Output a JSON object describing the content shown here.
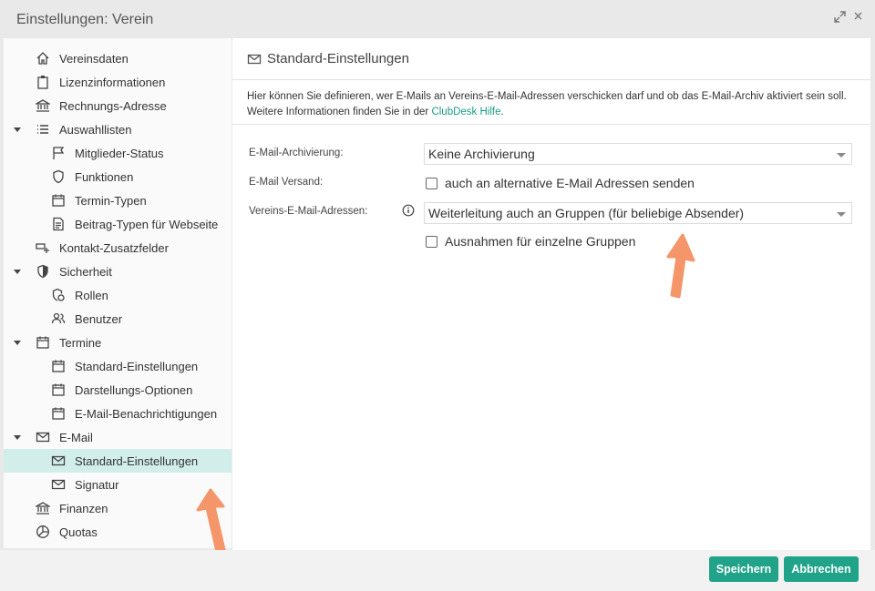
{
  "window": {
    "title": "Einstellungen: Verein"
  },
  "sidebar": {
    "items": [
      {
        "label": "Vereinsdaten",
        "icon": "home-icon"
      },
      {
        "label": "Lizenzinformationen",
        "icon": "clipboard-icon"
      },
      {
        "label": "Rechnungs-Adresse",
        "icon": "bank-icon"
      },
      {
        "label": "Auswahllisten",
        "icon": "list-icon",
        "expanded": true
      },
      {
        "label": "Mitglieder-Status",
        "icon": "flag-icon"
      },
      {
        "label": "Funktionen",
        "icon": "shield-icon"
      },
      {
        "label": "Termin-Typen",
        "icon": "calendar-icon"
      },
      {
        "label": "Beitrag-Typen für Webseite",
        "icon": "document-icon"
      },
      {
        "label": "Kontakt-Zusatzfelder",
        "icon": "field-add-icon"
      },
      {
        "label": "Sicherheit",
        "icon": "shield-check-icon",
        "expanded": true
      },
      {
        "label": "Rollen",
        "icon": "role-shield-icon"
      },
      {
        "label": "Benutzer",
        "icon": "users-icon"
      },
      {
        "label": "Termine",
        "icon": "calendar-icon",
        "expanded": true
      },
      {
        "label": "Standard-Einstellungen",
        "icon": "calendar-icon"
      },
      {
        "label": "Darstellungs-Optionen",
        "icon": "calendar-icon"
      },
      {
        "label": "E-Mail-Benachrichtigungen",
        "icon": "calendar-icon"
      },
      {
        "label": "E-Mail",
        "icon": "mail-icon",
        "expanded": true
      },
      {
        "label": "Standard-Einstellungen",
        "icon": "mail-icon",
        "selected": true
      },
      {
        "label": "Signatur",
        "icon": "mail-icon"
      },
      {
        "label": "Finanzen",
        "icon": "bank-icon"
      },
      {
        "label": "Quotas",
        "icon": "pie-chart-icon"
      }
    ]
  },
  "main": {
    "header": "Standard-Einstellungen",
    "info_text": "Hier können Sie definieren, wer E-Mails an Vereins-E-Mail-Adressen verschicken darf und ob das E-Mail-Archiv aktiviert sein soll. Weitere Informationen finden Sie in der ",
    "info_link": "ClubDesk Hilfe",
    "info_end": ".",
    "form": {
      "archive_label": "E-Mail-Archivierung:",
      "archive_value": "Keine Archivierung",
      "versand_label": "E-Mail Versand:",
      "versand_checkbox": "auch an alternative E-Mail Adressen senden",
      "addresses_label": "Vereins-E-Mail-Adressen:",
      "addresses_value": "Weiterleitung auch an Gruppen (für beliebige Absender)",
      "exceptions_checkbox": "Ausnahmen für einzelne Gruppen"
    }
  },
  "footer": {
    "save_label": "Speichern",
    "cancel_label": "Abbrechen"
  },
  "colors": {
    "accent": "#20a389",
    "selected_bg": "#d2eeea",
    "arrow": "#f4956a"
  }
}
